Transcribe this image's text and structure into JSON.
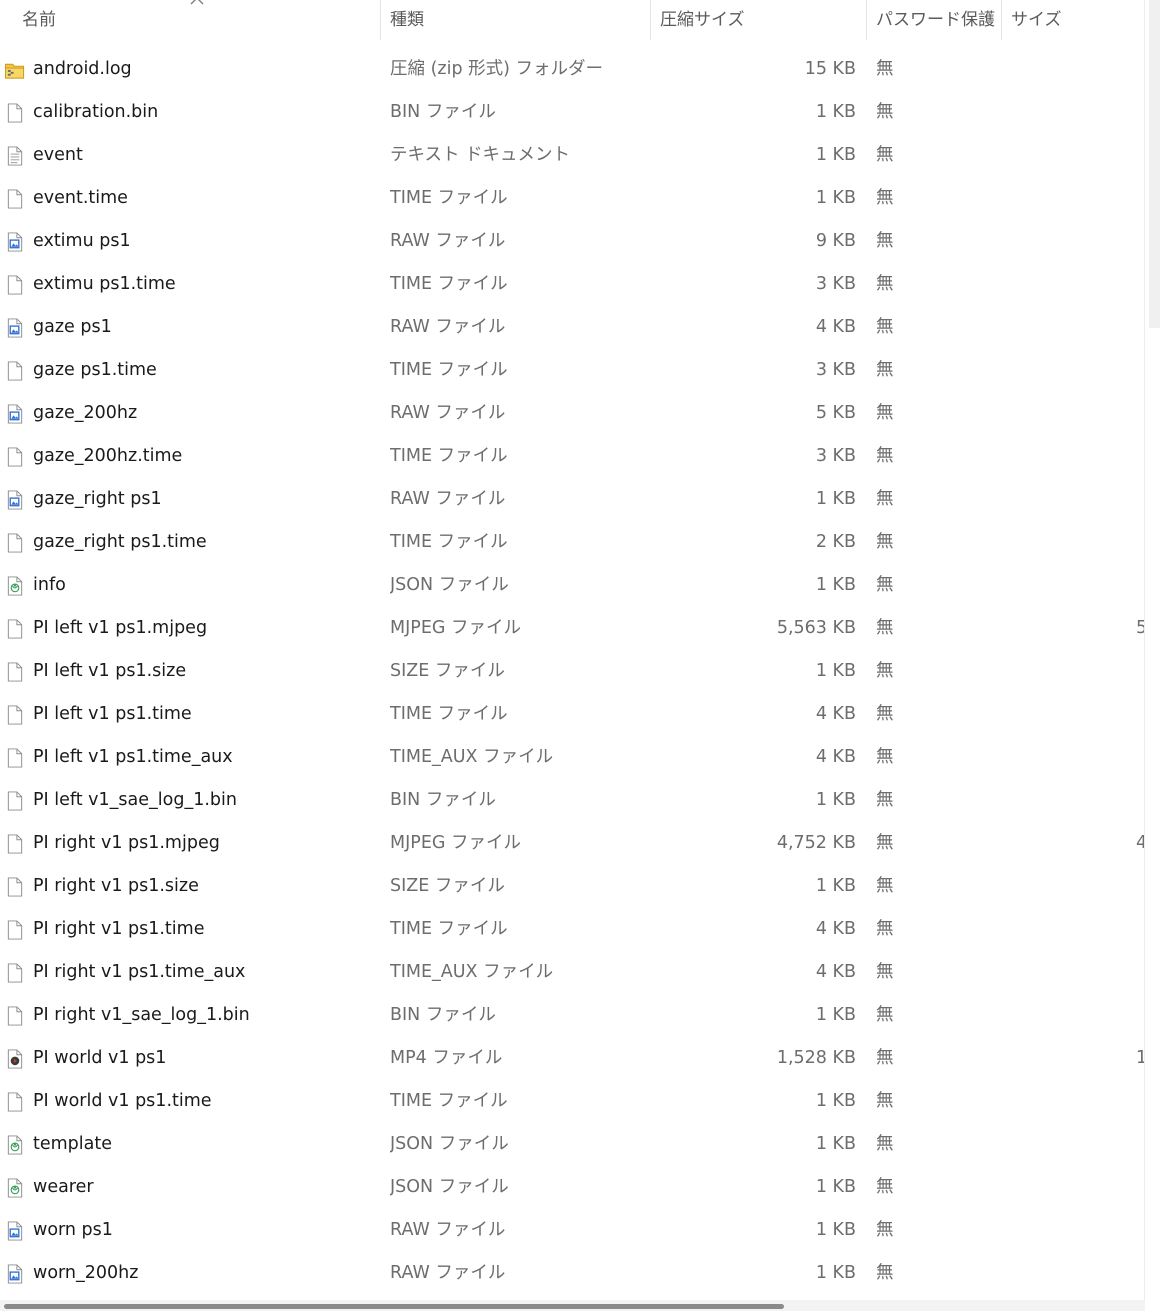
{
  "columns": {
    "name": "名前",
    "type": "種類",
    "compressed_size": "圧縮サイズ",
    "password": "パスワード保護",
    "size": "サイズ"
  },
  "files": [
    {
      "name": "android.log",
      "type": "圧縮 (zip 形式) フォルダー",
      "compressed_size": "15 KB",
      "password": "無",
      "size": "",
      "icon": "zip-folder-icon"
    },
    {
      "name": "calibration.bin",
      "type": "BIN ファイル",
      "compressed_size": "1 KB",
      "password": "無",
      "size": "",
      "icon": "file-icon"
    },
    {
      "name": "event",
      "type": "テキスト ドキュメント",
      "compressed_size": "1 KB",
      "password": "無",
      "size": "",
      "icon": "text-file-icon"
    },
    {
      "name": "event.time",
      "type": "TIME ファイル",
      "compressed_size": "1 KB",
      "password": "無",
      "size": "",
      "icon": "file-icon"
    },
    {
      "name": "extimu ps1",
      "type": "RAW ファイル",
      "compressed_size": "9 KB",
      "password": "無",
      "size": "",
      "icon": "raw-image-icon"
    },
    {
      "name": "extimu ps1.time",
      "type": "TIME ファイル",
      "compressed_size": "3 KB",
      "password": "無",
      "size": "",
      "icon": "file-icon"
    },
    {
      "name": "gaze ps1",
      "type": "RAW ファイル",
      "compressed_size": "4 KB",
      "password": "無",
      "size": "",
      "icon": "raw-image-icon"
    },
    {
      "name": "gaze ps1.time",
      "type": "TIME ファイル",
      "compressed_size": "3 KB",
      "password": "無",
      "size": "",
      "icon": "file-icon"
    },
    {
      "name": "gaze_200hz",
      "type": "RAW ファイル",
      "compressed_size": "5 KB",
      "password": "無",
      "size": "",
      "icon": "raw-image-icon"
    },
    {
      "name": "gaze_200hz.time",
      "type": "TIME ファイル",
      "compressed_size": "3 KB",
      "password": "無",
      "size": "",
      "icon": "file-icon"
    },
    {
      "name": "gaze_right ps1",
      "type": "RAW ファイル",
      "compressed_size": "1 KB",
      "password": "無",
      "size": "",
      "icon": "raw-image-icon"
    },
    {
      "name": "gaze_right ps1.time",
      "type": "TIME ファイル",
      "compressed_size": "2 KB",
      "password": "無",
      "size": "",
      "icon": "file-icon"
    },
    {
      "name": "info",
      "type": "JSON ファイル",
      "compressed_size": "1 KB",
      "password": "無",
      "size": "",
      "icon": "json-file-icon"
    },
    {
      "name": "PI left v1 ps1.mjpeg",
      "type": "MJPEG ファイル",
      "compressed_size": "5,563 KB",
      "password": "無",
      "size": "5",
      "icon": "file-icon"
    },
    {
      "name": "PI left v1 ps1.size",
      "type": "SIZE ファイル",
      "compressed_size": "1 KB",
      "password": "無",
      "size": "",
      "icon": "file-icon"
    },
    {
      "name": "PI left v1 ps1.time",
      "type": "TIME ファイル",
      "compressed_size": "4 KB",
      "password": "無",
      "size": "",
      "icon": "file-icon"
    },
    {
      "name": "PI left v1 ps1.time_aux",
      "type": "TIME_AUX ファイル",
      "compressed_size": "4 KB",
      "password": "無",
      "size": "",
      "icon": "file-icon"
    },
    {
      "name": "PI left v1_sae_log_1.bin",
      "type": "BIN ファイル",
      "compressed_size": "1 KB",
      "password": "無",
      "size": "",
      "icon": "file-icon"
    },
    {
      "name": "PI right v1 ps1.mjpeg",
      "type": "MJPEG ファイル",
      "compressed_size": "4,752 KB",
      "password": "無",
      "size": "4",
      "icon": "file-icon"
    },
    {
      "name": "PI right v1 ps1.size",
      "type": "SIZE ファイル",
      "compressed_size": "1 KB",
      "password": "無",
      "size": "",
      "icon": "file-icon"
    },
    {
      "name": "PI right v1 ps1.time",
      "type": "TIME ファイル",
      "compressed_size": "4 KB",
      "password": "無",
      "size": "",
      "icon": "file-icon"
    },
    {
      "name": "PI right v1 ps1.time_aux",
      "type": "TIME_AUX ファイル",
      "compressed_size": "4 KB",
      "password": "無",
      "size": "",
      "icon": "file-icon"
    },
    {
      "name": "PI right v1_sae_log_1.bin",
      "type": "BIN ファイル",
      "compressed_size": "1 KB",
      "password": "無",
      "size": "",
      "icon": "file-icon"
    },
    {
      "name": "PI world v1 ps1",
      "type": "MP4 ファイル",
      "compressed_size": "1,528 KB",
      "password": "無",
      "size": "1",
      "icon": "video-file-icon"
    },
    {
      "name": "PI world v1 ps1.time",
      "type": "TIME ファイル",
      "compressed_size": "1 KB",
      "password": "無",
      "size": "",
      "icon": "file-icon"
    },
    {
      "name": "template",
      "type": "JSON ファイル",
      "compressed_size": "1 KB",
      "password": "無",
      "size": "",
      "icon": "json-file-icon"
    },
    {
      "name": "wearer",
      "type": "JSON ファイル",
      "compressed_size": "1 KB",
      "password": "無",
      "size": "",
      "icon": "json-file-icon"
    },
    {
      "name": "worn ps1",
      "type": "RAW ファイル",
      "compressed_size": "1 KB",
      "password": "無",
      "size": "",
      "icon": "raw-image-icon"
    },
    {
      "name": "worn_200hz",
      "type": "RAW ファイル",
      "compressed_size": "1 KB",
      "password": "無",
      "size": "",
      "icon": "raw-image-icon"
    }
  ],
  "colors": {
    "header_text": "#5b5b5b",
    "name_text": "#1a1a1a",
    "secondary_text": "#6d6d6d",
    "zip_folder": "#f5c542",
    "raw_icon_accent": "#2f6fd6",
    "json_icon_accent": "#3a9d5d",
    "video_icon_accent": "#b5452b"
  }
}
